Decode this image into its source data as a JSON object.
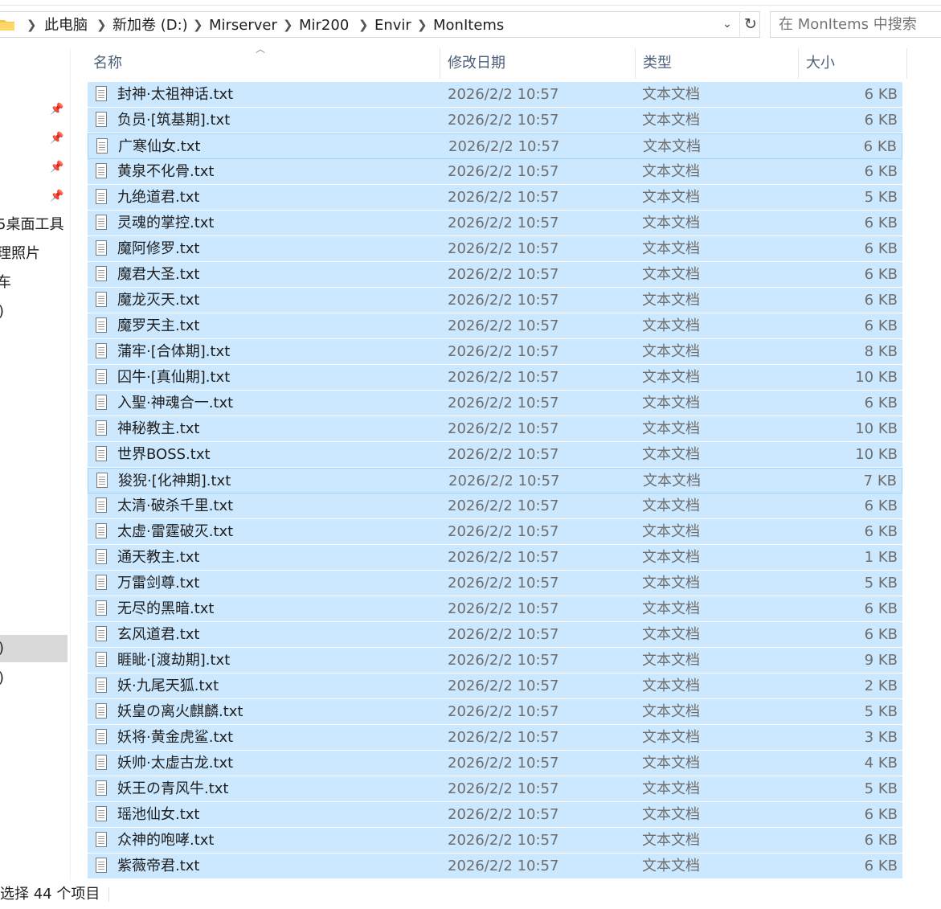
{
  "address": {
    "crumbs": [
      "此电脑",
      "新加卷 (D:)",
      "Mirserver",
      "Mir200",
      "Envir",
      "MonItems"
    ]
  },
  "search": {
    "placeholder": "在 MonItems 中搜索"
  },
  "nav": {
    "items": [
      "5桌面工具",
      "理照片",
      "车",
      ")",
      ")",
      ")"
    ]
  },
  "columns": {
    "name": "名称",
    "date": "修改日期",
    "type": "类型",
    "size": "大小"
  },
  "files": [
    {
      "name": "封神·太祖神话.txt",
      "date": "2026/2/2 10:57",
      "type": "文本文档",
      "size": "6 KB"
    },
    {
      "name": "负员·[筑基期].txt",
      "date": "2026/2/2 10:57",
      "type": "文本文档",
      "size": "6 KB"
    },
    {
      "name": "广寒仙女.txt",
      "date": "2026/2/2 10:57",
      "type": "文本文档",
      "size": "6 KB"
    },
    {
      "name": "黄泉不化骨.txt",
      "date": "2026/2/2 10:57",
      "type": "文本文档",
      "size": "6 KB"
    },
    {
      "name": "九绝道君.txt",
      "date": "2026/2/2 10:57",
      "type": "文本文档",
      "size": "5 KB"
    },
    {
      "name": "灵魂的掌控.txt",
      "date": "2026/2/2 10:57",
      "type": "文本文档",
      "size": "6 KB"
    },
    {
      "name": "魔阿修罗.txt",
      "date": "2026/2/2 10:57",
      "type": "文本文档",
      "size": "6 KB"
    },
    {
      "name": "魔君大圣.txt",
      "date": "2026/2/2 10:57",
      "type": "文本文档",
      "size": "6 KB"
    },
    {
      "name": "魔龙灭天.txt",
      "date": "2026/2/2 10:57",
      "type": "文本文档",
      "size": "6 KB"
    },
    {
      "name": "魔罗天主.txt",
      "date": "2026/2/2 10:57",
      "type": "文本文档",
      "size": "6 KB"
    },
    {
      "name": "蒲牢·[合体期].txt",
      "date": "2026/2/2 10:57",
      "type": "文本文档",
      "size": "8 KB"
    },
    {
      "name": "囚牛·[真仙期].txt",
      "date": "2026/2/2 10:57",
      "type": "文本文档",
      "size": "10 KB"
    },
    {
      "name": "入聖·神魂合一.txt",
      "date": "2026/2/2 10:57",
      "type": "文本文档",
      "size": "6 KB"
    },
    {
      "name": "神秘教主.txt",
      "date": "2026/2/2 10:57",
      "type": "文本文档",
      "size": "10 KB"
    },
    {
      "name": "世界BOSS.txt",
      "date": "2026/2/2 10:57",
      "type": "文本文档",
      "size": "10 KB"
    },
    {
      "name": "狻猊·[化神期].txt",
      "date": "2026/2/2 10:57",
      "type": "文本文档",
      "size": "7 KB"
    },
    {
      "name": "太清·破杀千里.txt",
      "date": "2026/2/2 10:57",
      "type": "文本文档",
      "size": "6 KB"
    },
    {
      "name": "太虚·雷霆破灭.txt",
      "date": "2026/2/2 10:57",
      "type": "文本文档",
      "size": "6 KB"
    },
    {
      "name": "通天教主.txt",
      "date": "2026/2/2 10:57",
      "type": "文本文档",
      "size": "1 KB"
    },
    {
      "name": "万雷剑尊.txt",
      "date": "2026/2/2 10:57",
      "type": "文本文档",
      "size": "5 KB"
    },
    {
      "name": "无尽的黑暗.txt",
      "date": "2026/2/2 10:57",
      "type": "文本文档",
      "size": "6 KB"
    },
    {
      "name": "玄风道君.txt",
      "date": "2026/2/2 10:57",
      "type": "文本文档",
      "size": "6 KB"
    },
    {
      "name": "睚眦·[渡劫期].txt",
      "date": "2026/2/2 10:57",
      "type": "文本文档",
      "size": "9 KB"
    },
    {
      "name": "妖·九尾天狐.txt",
      "date": "2026/2/2 10:57",
      "type": "文本文档",
      "size": "2 KB"
    },
    {
      "name": "妖皇の离火麒麟.txt",
      "date": "2026/2/2 10:57",
      "type": "文本文档",
      "size": "5 KB"
    },
    {
      "name": "妖将·黄金虎鲨.txt",
      "date": "2026/2/2 10:57",
      "type": "文本文档",
      "size": "3 KB"
    },
    {
      "name": "妖帅·太虚古龙.txt",
      "date": "2026/2/2 10:57",
      "type": "文本文档",
      "size": "4 KB"
    },
    {
      "name": "妖王の青风牛.txt",
      "date": "2026/2/2 10:57",
      "type": "文本文档",
      "size": "5 KB"
    },
    {
      "name": "瑶池仙女.txt",
      "date": "2026/2/2 10:57",
      "type": "文本文档",
      "size": "6 KB"
    },
    {
      "name": "众神的咆哮.txt",
      "date": "2026/2/2 10:57",
      "type": "文本文档",
      "size": "6 KB"
    },
    {
      "name": "紫薇帝君.txt",
      "date": "2026/2/2 10:57",
      "type": "文本文档",
      "size": "6 KB"
    }
  ],
  "status": {
    "text": "选择 44 个项目"
  },
  "colors": {
    "selection": "#cce8ff",
    "selection_border": "#99d1ff",
    "header_text": "#4c607a"
  },
  "icons": [
    "folder-icon",
    "chevron-right-icon",
    "chevron-down-icon",
    "refresh-icon",
    "pin-icon",
    "text-file-icon",
    "sort-up-icon"
  ]
}
